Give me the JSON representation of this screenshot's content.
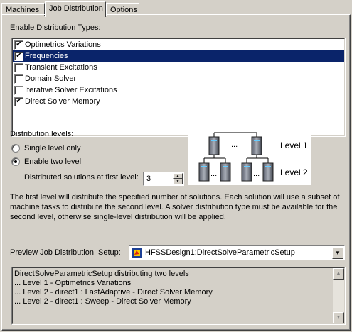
{
  "tabs": [
    "Machines",
    "Job Distribution",
    "Options"
  ],
  "active_tab": 1,
  "enable_types": {
    "label": "Enable Distribution Types:",
    "items": [
      {
        "label": "Optimetrics Variations",
        "checked": true,
        "selected": false
      },
      {
        "label": "Frequencies",
        "checked": true,
        "selected": true
      },
      {
        "label": "Transient Excitations",
        "checked": false,
        "selected": false
      },
      {
        "label": "Domain Solver",
        "checked": false,
        "selected": false
      },
      {
        "label": "Iterative Solver Excitations",
        "checked": false,
        "selected": false
      },
      {
        "label": "Direct Solver Memory",
        "checked": true,
        "selected": false
      }
    ]
  },
  "levels": {
    "label": "Distribution levels:",
    "single_label": "Single level only",
    "two_label": "Enable two level",
    "selected": "two",
    "first_level_label": "Distributed solutions at first level:",
    "first_level_value": "3"
  },
  "diagram": {
    "level1_label": "Level 1",
    "level2_label": "Level 2",
    "ellipsis": "..."
  },
  "description": "The first level will distribute the specified number of solutions. Each solution will use a subset of machine tasks to distribute the second level. A solver distribution type must be available for the second level, otherwise single-level distribution will be applied.",
  "preview": {
    "label": "Preview Job Distribution",
    "setup_label": "Setup:",
    "setup_value": "HFSSDesign1:DirectSolveParametricSetup",
    "lines": [
      "DirectSolveParametricSetup distributing two levels",
      "... Level 1 - Optimetrics Variations",
      "... Level 2 - direct1 : LastAdaptive - Direct Solver Memory",
      "... Level 2 - direct1 : Sweep - Direct Solver Memory"
    ]
  },
  "colors": {
    "face": "#d4d0c8",
    "selection": "#0a246a"
  }
}
